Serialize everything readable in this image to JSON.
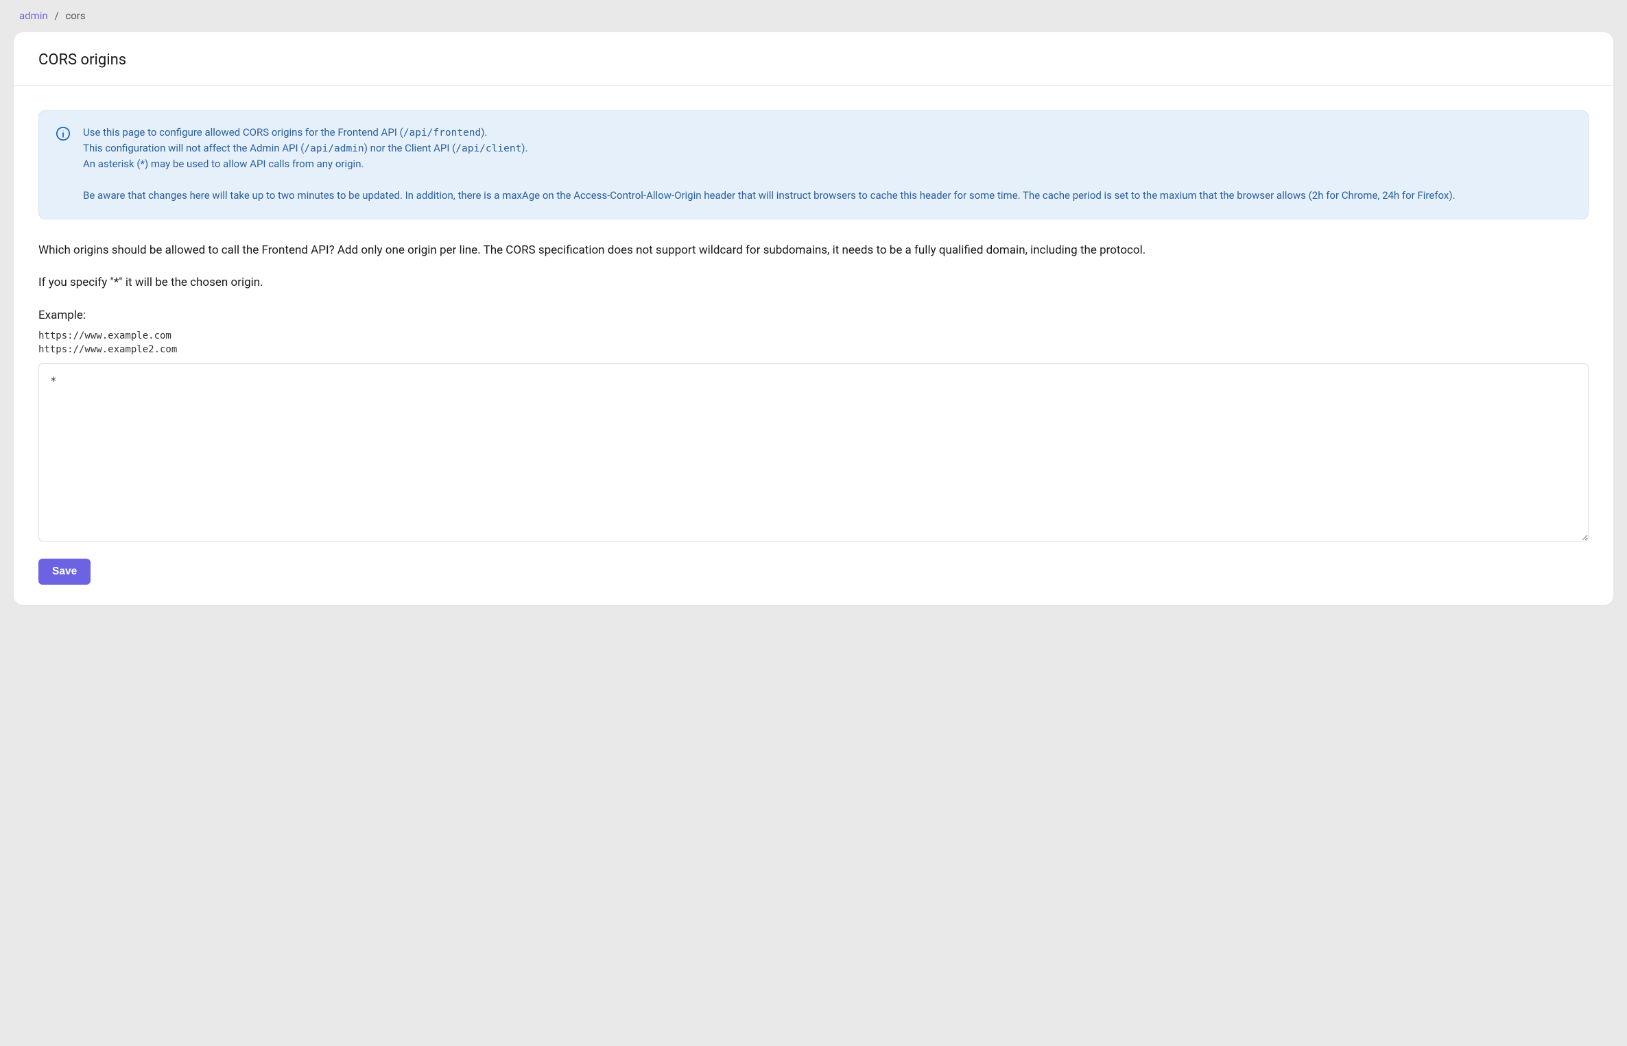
{
  "breadcrumb": {
    "parent": "admin",
    "separator": "/",
    "current": "cors"
  },
  "header": {
    "title": "CORS origins"
  },
  "alert": {
    "line1_part1": "Use this page to configure allowed CORS origins for the Frontend API (",
    "line1_code": "/api/frontend",
    "line1_part2": ").",
    "line2_part1": "This configuration will not affect the Admin API (",
    "line2_code1": "/api/admin",
    "line2_part2": ") nor the Client API (",
    "line2_code2": "/api/client",
    "line2_part3": ").",
    "line3": "An asterisk (*) may be used to allow API calls from any origin.",
    "line4": "Be aware that changes here will take up to two minutes to be updated. In addition, there is a maxAge on the Access-Control-Allow-Origin header that will instruct browsers to cache this header for some time. The cache period is set to the maxium that the browser allows (2h for Chrome, 24h for Firefox)."
  },
  "body": {
    "instructions": "Which origins should be allowed to call the Frontend API? Add only one origin per line. The CORS specification does not support wildcard for subdomains, it needs to be a fully qualified domain, including the protocol.",
    "asterisk_note": "If you specify \"*\" it will be the chosen origin.",
    "example_label": "Example:",
    "example_code": "https://www.example.com\nhttps://www.example2.com",
    "textarea_value": "*"
  },
  "actions": {
    "save_label": "Save"
  }
}
